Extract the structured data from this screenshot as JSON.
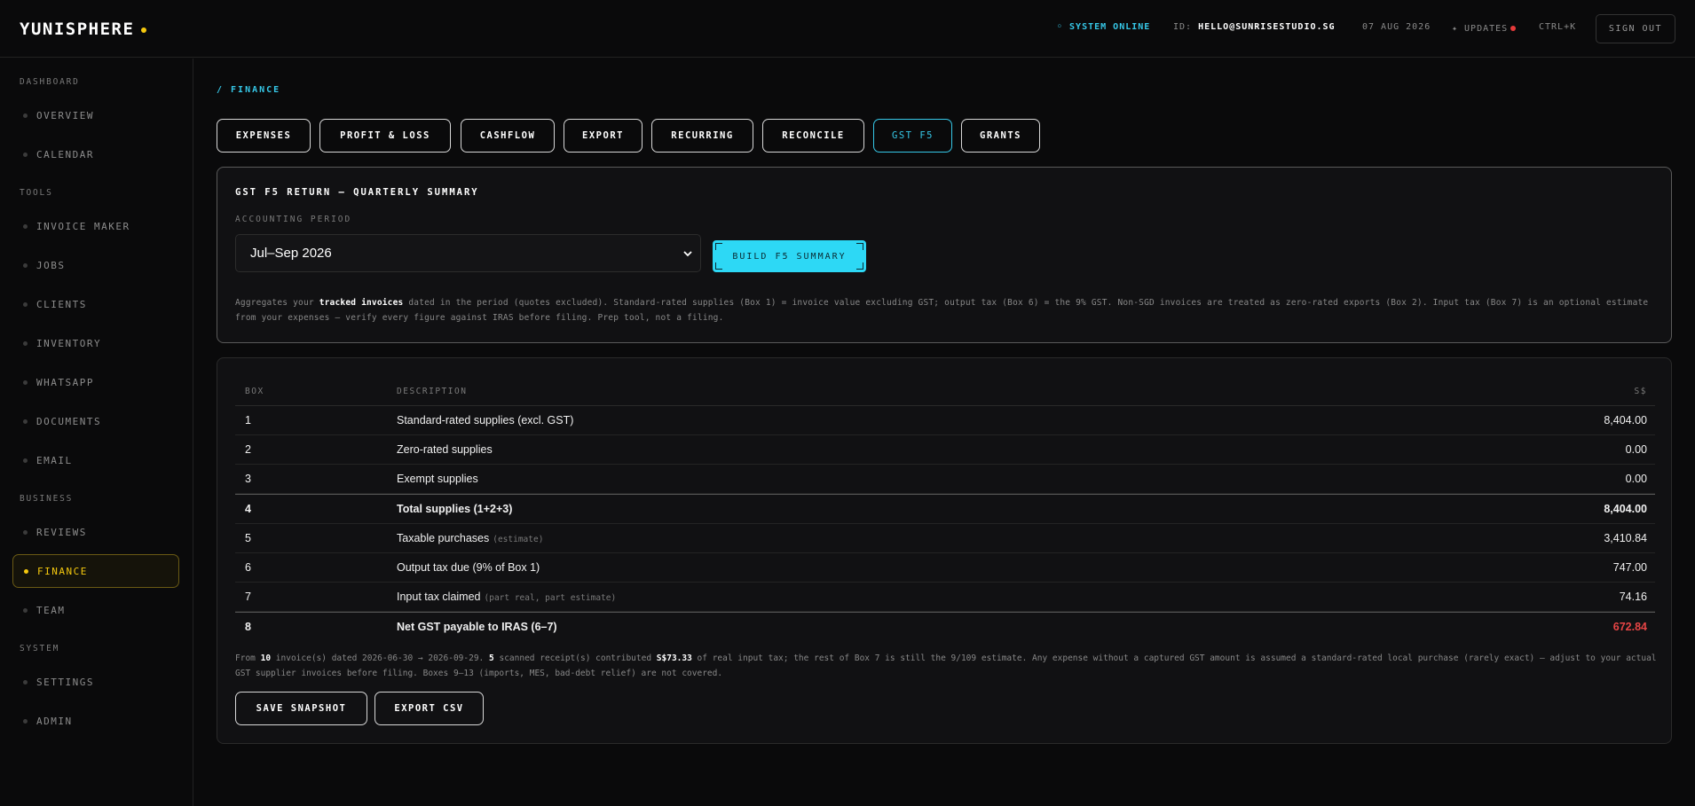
{
  "app": {
    "name": "YUNISPHERE"
  },
  "header": {
    "status": "◦ SYSTEM ONLINE",
    "id_label": "ID:",
    "id_value": "HELLO@SUNRISESTUDIO.SG",
    "date": "07 AUG 2026",
    "updates": "✦ UPDATES",
    "shortcut": "CTRL+K",
    "sign_out": "SIGN OUT"
  },
  "sidebar": {
    "sections": [
      {
        "title": "DASHBOARD",
        "items": [
          "OVERVIEW",
          "CALENDAR"
        ]
      },
      {
        "title": "TOOLS",
        "items": [
          "INVOICE MAKER",
          "JOBS",
          "CLIENTS",
          "INVENTORY",
          "WHATSAPP",
          "DOCUMENTS",
          "EMAIL"
        ]
      },
      {
        "title": "BUSINESS",
        "items": [
          "REVIEWS",
          "FINANCE",
          "TEAM"
        ]
      },
      {
        "title": "SYSTEM",
        "items": [
          "SETTINGS",
          "ADMIN"
        ]
      }
    ],
    "active": "FINANCE"
  },
  "breadcrumb": "/ FINANCE",
  "tabs": [
    "EXPENSES",
    "PROFIT & LOSS",
    "CASHFLOW",
    "EXPORT",
    "RECURRING",
    "RECONCILE",
    "GST F5",
    "GRANTS"
  ],
  "active_tab": "GST F5",
  "gst": {
    "title": "GST F5 RETURN — QUARTERLY SUMMARY",
    "period_label": "ACCOUNTING PERIOD",
    "period_value": "Jul–Sep 2026",
    "build_button": "BUILD F5 SUMMARY",
    "note_pre": "Aggregates your ",
    "note_bold": "tracked invoices",
    "note_post": " dated in the period (quotes excluded). Standard-rated supplies (Box 1) = invoice value excluding GST; output tax (Box 6) = the 9% GST. Non-SGD invoices are treated as zero-rated exports (Box 2). Input tax (Box 7) is an optional estimate from your expenses — verify every figure against IRAS before filing. Prep tool, not a filing."
  },
  "table": {
    "headers": {
      "box": "BOX",
      "description": "DESCRIPTION",
      "amount": "S$"
    },
    "rows": [
      {
        "box": "1",
        "description": "Standard-rated supplies (excl. GST)",
        "hint": "",
        "amount": "8,404.00",
        "strong": false,
        "red": false
      },
      {
        "box": "2",
        "description": "Zero-rated supplies",
        "hint": "",
        "amount": "0.00",
        "strong": false,
        "red": false
      },
      {
        "box": "3",
        "description": "Exempt supplies",
        "hint": "",
        "amount": "0.00",
        "strong": false,
        "red": false
      },
      {
        "box": "4",
        "description": "Total supplies (1+2+3)",
        "hint": "",
        "amount": "8,404.00",
        "strong": true,
        "red": false
      },
      {
        "box": "5",
        "description": "Taxable purchases",
        "hint": "(estimate)",
        "amount": "3,410.84",
        "strong": false,
        "red": false
      },
      {
        "box": "6",
        "description": "Output tax due (9% of Box 1)",
        "hint": "",
        "amount": "747.00",
        "strong": false,
        "red": false
      },
      {
        "box": "7",
        "description": "Input tax claimed",
        "hint": "(part real, part estimate)",
        "amount": "74.16",
        "strong": false,
        "red": false
      },
      {
        "box": "8",
        "description": "Net GST payable to IRAS (6–7)",
        "hint": "",
        "amount": "672.84",
        "strong": true,
        "red": true
      }
    ],
    "note_a": "From ",
    "note_invoices": "10",
    "note_b": " invoice(s) dated 2026-06-30 → 2026-09-29. ",
    "note_receipts": "5",
    "note_c": " scanned receipt(s) contributed ",
    "note_amount": "S$73.33",
    "note_d": " of real input tax; the rest of Box 7 is still the 9/109 estimate. Any expense without a captured GST amount is assumed a standard-rated local purchase (rarely exact) — adjust to your actual GST supplier invoices before filing. Boxes 9–13 (imports, MES, bad-debt relief) are not covered."
  },
  "actions": {
    "save": "SAVE SNAPSHOT",
    "export": "EXPORT CSV"
  },
  "colors": {
    "accent": "#36c8e8",
    "active": "#f6c90e",
    "danger": "#e64545",
    "background": "#0a0a0b"
  }
}
